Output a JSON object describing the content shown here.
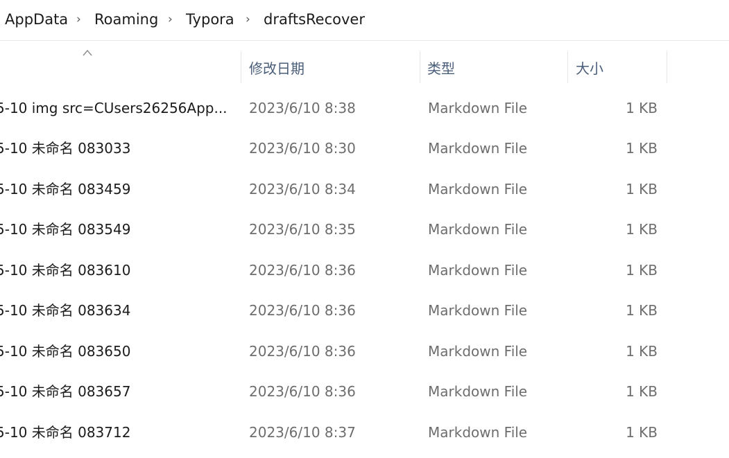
{
  "breadcrumb": {
    "items": [
      "AppData",
      "Roaming",
      "Typora",
      "draftsRecover"
    ],
    "separator": "›"
  },
  "columns": {
    "name": "",
    "date": "修改日期",
    "type": "类型",
    "size": "大小"
  },
  "sort_icon": "sort-ascending-icon",
  "files": [
    {
      "name": "5-10 img src=CUsers26256App...",
      "date": "2023/6/10 8:38",
      "type": "Markdown File",
      "size": "1 KB"
    },
    {
      "name": "5-10 未命名 083033",
      "date": "2023/6/10 8:30",
      "type": "Markdown File",
      "size": "1 KB"
    },
    {
      "name": "5-10 未命名 083459",
      "date": "2023/6/10 8:34",
      "type": "Markdown File",
      "size": "1 KB"
    },
    {
      "name": "5-10 未命名 083549",
      "date": "2023/6/10 8:35",
      "type": "Markdown File",
      "size": "1 KB"
    },
    {
      "name": "5-10 未命名 083610",
      "date": "2023/6/10 8:36",
      "type": "Markdown File",
      "size": "1 KB"
    },
    {
      "name": "5-10 未命名 083634",
      "date": "2023/6/10 8:36",
      "type": "Markdown File",
      "size": "1 KB"
    },
    {
      "name": "5-10 未命名 083650",
      "date": "2023/6/10 8:36",
      "type": "Markdown File",
      "size": "1 KB"
    },
    {
      "name": "5-10 未命名 083657",
      "date": "2023/6/10 8:36",
      "type": "Markdown File",
      "size": "1 KB"
    },
    {
      "name": "5-10 未命名 083712",
      "date": "2023/6/10 8:37",
      "type": "Markdown File",
      "size": "1 KB"
    }
  ],
  "colors": {
    "header_text": "#4a5e7a",
    "name_text": "#1b1b1b",
    "meta_text": "#6d6d6d"
  }
}
